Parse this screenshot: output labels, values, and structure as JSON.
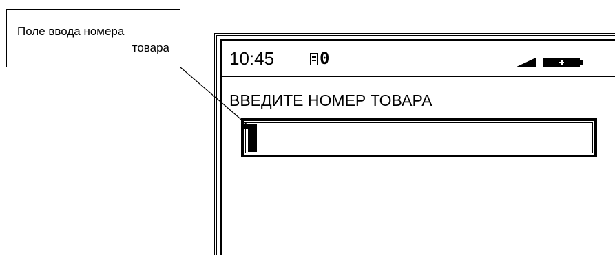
{
  "callout": {
    "line1": "Поле ввода номера",
    "line2": "товара"
  },
  "status_bar": {
    "time": "10:45",
    "receipt_icon": "receipt-icon",
    "counter": "0",
    "signal_icon": "signal-icon",
    "battery_icon": "battery-icon"
  },
  "prompt": "ВВЕДИТЕ НОМЕР ТОВАРА",
  "input": {
    "value": ""
  },
  "colors": {
    "foreground": "#000000",
    "background": "#ffffff"
  }
}
